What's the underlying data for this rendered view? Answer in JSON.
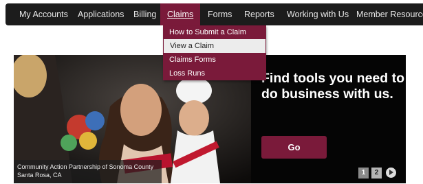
{
  "nav": {
    "items": [
      {
        "label": "My Accounts"
      },
      {
        "label": "Applications"
      },
      {
        "label": "Billing"
      },
      {
        "label": "Claims",
        "active": true
      },
      {
        "label": "Forms"
      },
      {
        "label": "Reports"
      },
      {
        "label": "Working with Us"
      },
      {
        "label": "Member Resources"
      }
    ]
  },
  "claims_menu": {
    "items": [
      {
        "label": "How to Submit a Claim"
      },
      {
        "label": "View a Claim",
        "hovered": true
      },
      {
        "label": "Claims Forms"
      },
      {
        "label": "Loss Runs"
      }
    ]
  },
  "hero": {
    "heading": "Find tools you need to do business with us.",
    "cta_label": "Go",
    "caption_line1": "Community Action Partnership of Sonoma County",
    "caption_line2": "Santa Rosa, CA",
    "pages": [
      "1",
      "2"
    ],
    "current_page": "2"
  },
  "colors": {
    "nav_bg": "#1c1c1c",
    "accent": "#7a1a3a",
    "hero_bg": "#050505"
  },
  "icons": {
    "next_slide": "play-circle-icon"
  }
}
